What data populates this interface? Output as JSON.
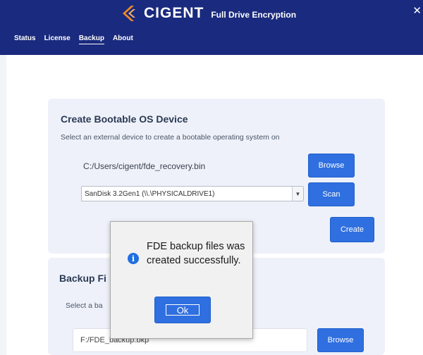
{
  "app": {
    "brand": "CIGENT",
    "product": "Full Drive Encryption",
    "close_symbol": "✕"
  },
  "nav": {
    "tabs": [
      {
        "label": "Status"
      },
      {
        "label": "License"
      },
      {
        "label": "Backup",
        "active": true
      },
      {
        "label": "About"
      }
    ]
  },
  "bootable": {
    "title": "Create Bootable OS Device",
    "description": "Select an external device to create a bootable operating system on",
    "path": "C:/Users/cigent/fde_recovery.bin",
    "browse_label": "Browse",
    "device_selected": "SanDisk 3.2Gen1 (\\\\.\\PHYSICALDRIVE1)",
    "scan_label": "Scan",
    "create_label": "Create"
  },
  "backup": {
    "title": "Backup Fi",
    "description": "Select a ba",
    "path": "F:/FDE_backup.bkp",
    "browse_label": "Browse"
  },
  "dialog": {
    "message": "FDE backup files was created successfully.",
    "ok_label": "Ok",
    "icon": "info-icon"
  },
  "colors": {
    "header_bg": "#1a2a7e",
    "accent": "#2f6fe0",
    "logo": "#f08a24",
    "card_bg": "#eef1f9"
  }
}
